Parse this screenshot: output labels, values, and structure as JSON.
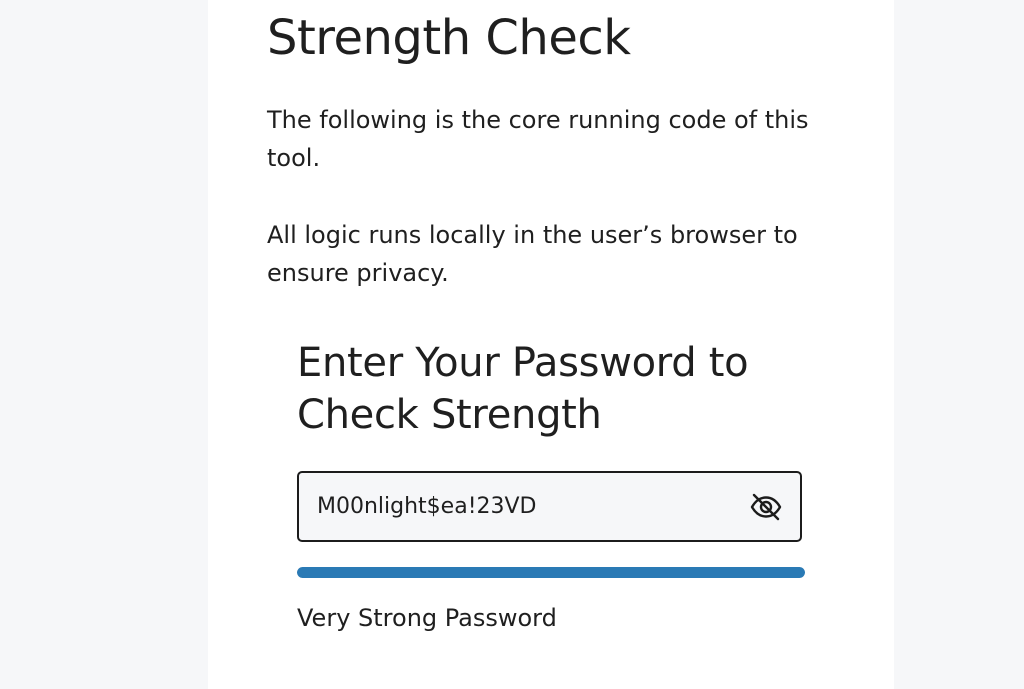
{
  "page": {
    "title": "Strength Check",
    "paragraph_1": "The following is the core running code of this tool.",
    "paragraph_2": "All logic runs locally in the user’s browser to ensure privacy."
  },
  "checker": {
    "heading": "Enter Your Password to Check Strength",
    "password_value": "M00nlight$ea!23VD",
    "toggle_icon": "eye-off-icon",
    "strength_level": 1.0,
    "strength_color": "#2a7ab5",
    "strength_label": "Very Strong Password"
  }
}
